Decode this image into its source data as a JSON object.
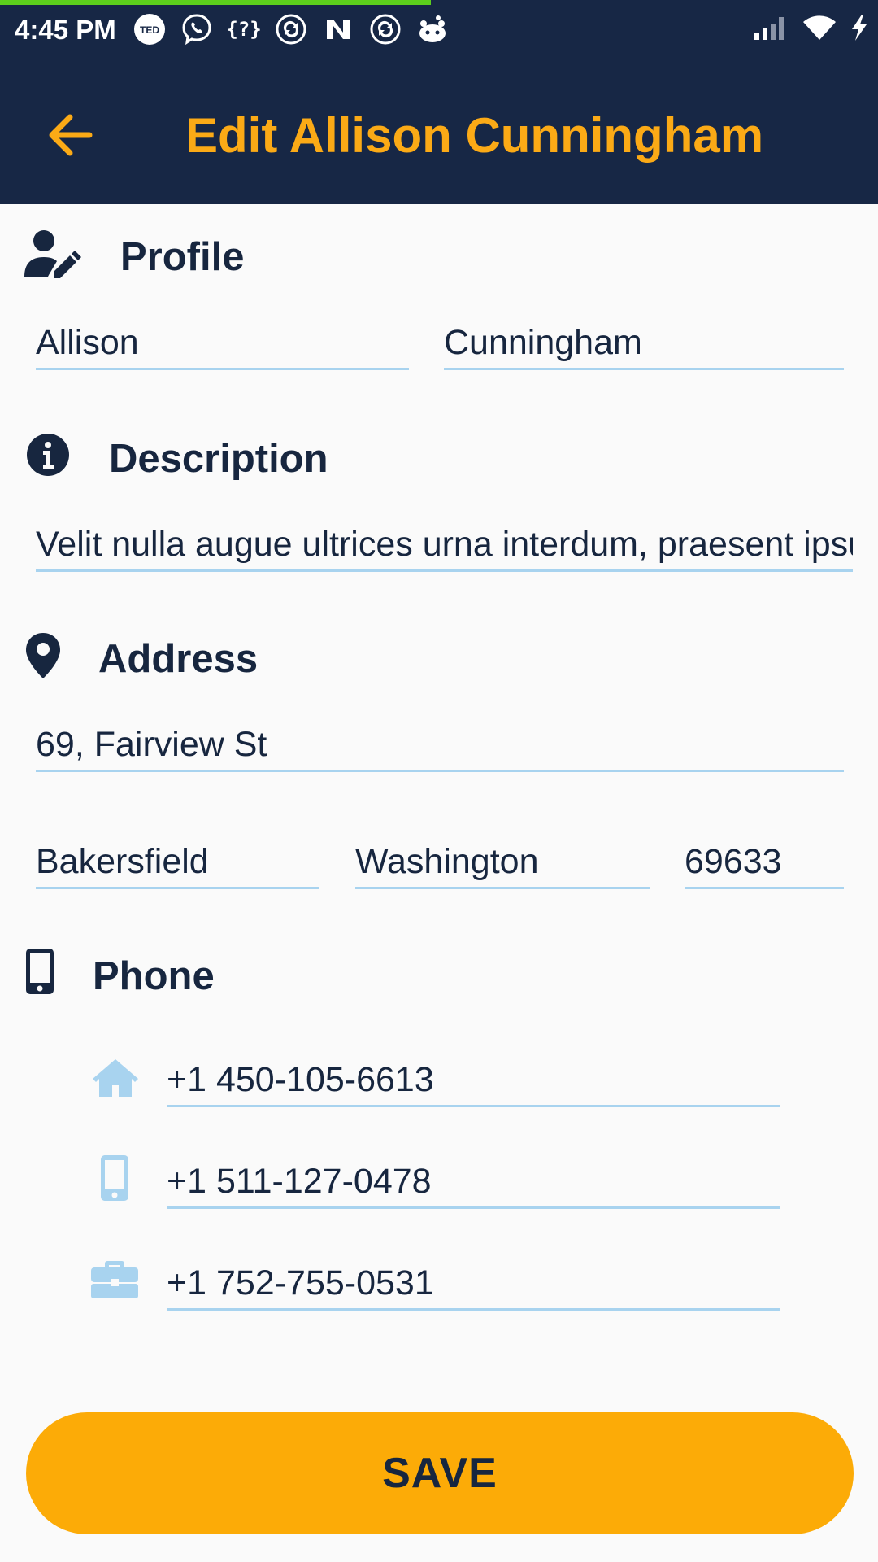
{
  "status_bar": {
    "time": "4:45 PM",
    "notification_icons": [
      "ted-icon",
      "viber-icon",
      "unknown-app-icon",
      "sync-icon",
      "n-app-icon",
      "sync-icon",
      "reddit-icon"
    ]
  },
  "header": {
    "title": "Edit Allison Cunningham"
  },
  "profile": {
    "heading": "Profile",
    "first_name": "Allison",
    "last_name": "Cunningham"
  },
  "description": {
    "heading": "Description",
    "text": "Velit nulla augue ultrices urna interdum, praesent ipsum"
  },
  "address": {
    "heading": "Address",
    "street": "69, Fairview St",
    "city": "Bakersfield",
    "state": "Washington",
    "zip": "69633"
  },
  "phone": {
    "heading": "Phone",
    "home": "+1 450-105-6613",
    "mobile": "+1 511-127-0478",
    "work": "+1 752-755-0531"
  },
  "actions": {
    "save_label": "SAVE"
  },
  "colors": {
    "navy": "#172745",
    "accent": "#fbaa16",
    "field_underline": "#a8d3ef",
    "phone_icon": "#a8d3ef"
  }
}
